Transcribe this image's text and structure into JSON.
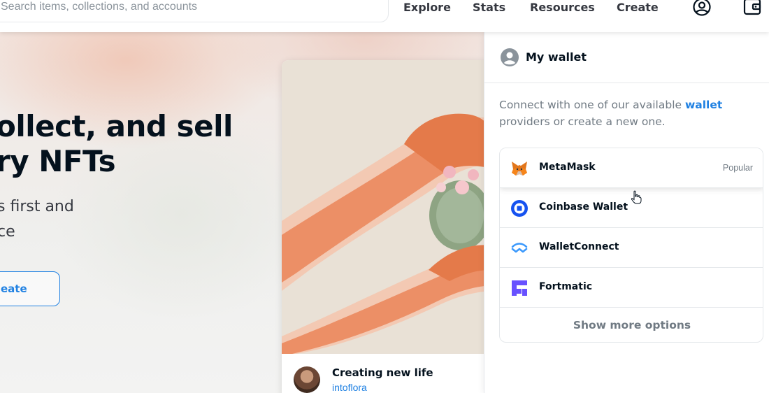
{
  "search": {
    "placeholder": "Search items, collections, and accounts"
  },
  "nav": {
    "links": [
      "Explore",
      "Stats",
      "Resources",
      "Create"
    ],
    "profile_icon": "account-circle-icon",
    "wallet_icon": "wallet-icon"
  },
  "hero": {
    "title_line1": "ollect, and sell",
    "title_line2": "ry NFTs",
    "subtitle_line1": "s first and",
    "subtitle_line2": "ce",
    "button_label": "eate"
  },
  "featured": {
    "title": "Creating new life",
    "author": "intoflora"
  },
  "wallet_panel": {
    "title": "My wallet",
    "description_pre": "Connect with one of our available ",
    "description_link": "wallet",
    "description_post": " providers or create a new one.",
    "wallets": [
      {
        "name": "MetaMask",
        "badge": "Popular",
        "icon": "metamask-fox-icon"
      },
      {
        "name": "Coinbase Wallet",
        "badge": "",
        "icon": "coinbase-icon"
      },
      {
        "name": "WalletConnect",
        "badge": "",
        "icon": "walletconnect-icon"
      },
      {
        "name": "Fortmatic",
        "badge": "",
        "icon": "fortmatic-icon"
      }
    ],
    "show_more_label": "Show more options"
  },
  "colors": {
    "accent": "#2081e2",
    "text_dark": "#04111d",
    "text_muted": "#707a83",
    "border": "#e5e8eb"
  }
}
